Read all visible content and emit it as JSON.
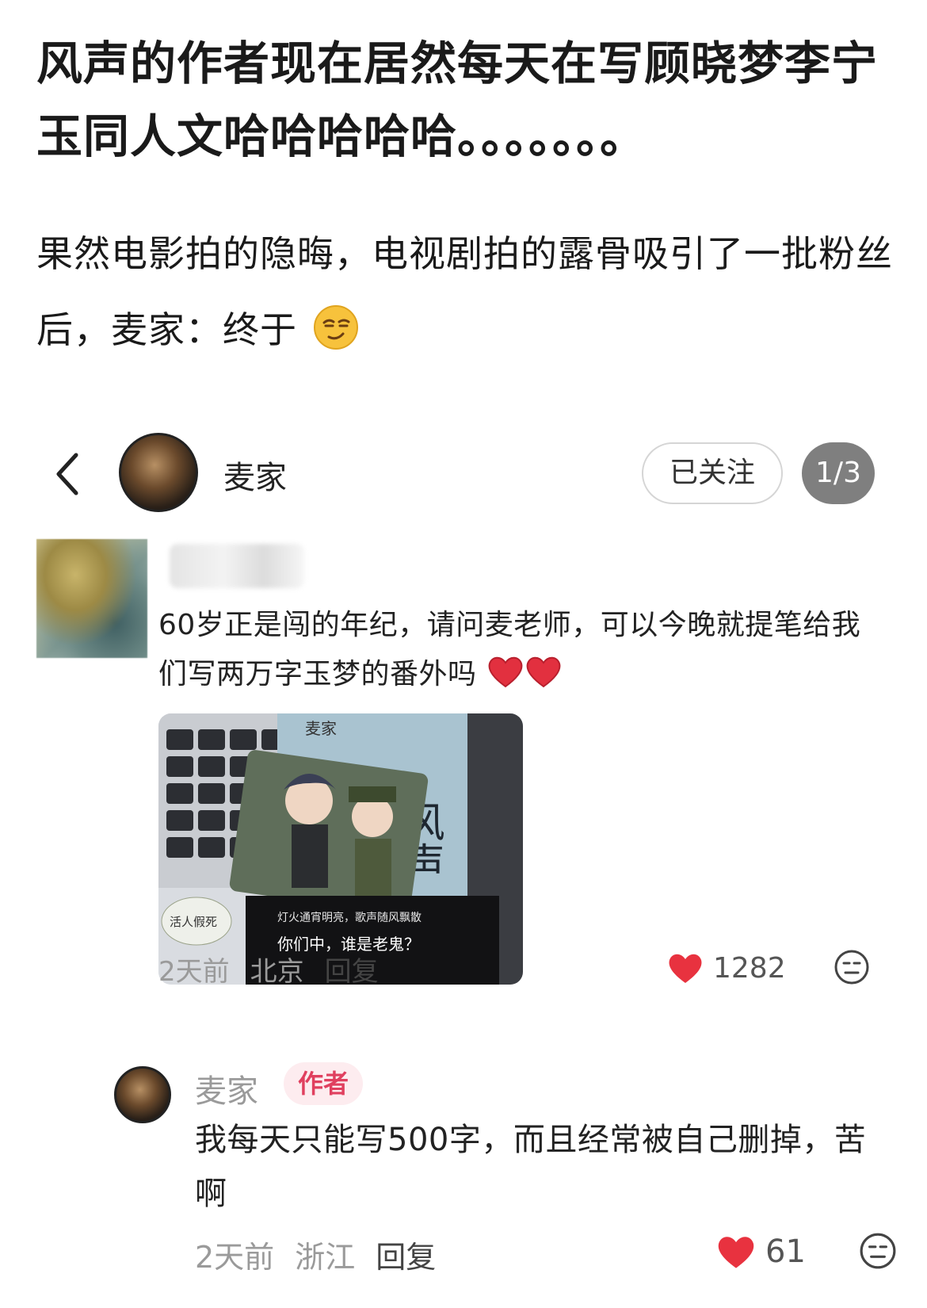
{
  "post": {
    "title": "风声的作者现在居然每天在写顾晓梦李宁玉同人文哈哈哈哈哈。。。。。。。",
    "body": "果然电影拍的隐晦，电视剧拍的露骨吸引了一批粉丝后，麦家：终于"
  },
  "screenshot": {
    "header": {
      "author_name": "麦家",
      "follow_label": "已关注",
      "page_indicator": "1/3"
    },
    "comment": {
      "text": "60岁正是闯的年纪，请问麦老师，可以今晚就提笔给我们写两万字玉梦的番外吗",
      "photo": {
        "book_title": "风声",
        "book_author": "麦家",
        "sticker_text": "活人假死",
        "cover_line1": "灯火通宵明亮，歌声随风飘散",
        "cover_line2": "你们中，谁是老鬼？"
      },
      "time": "2天前",
      "location": "北京",
      "reply_label": "回复",
      "likes": "1282"
    },
    "reply": {
      "author_name": "麦家",
      "badge": "作者",
      "text": "我每天只能写500字，而且经常被自己删掉，苦啊",
      "time": "2天前",
      "location": "浙江",
      "reply_label": "回复",
      "likes": "61"
    }
  },
  "colors": {
    "like_heart": "#e8323f",
    "badge_text": "#e0405f",
    "badge_bg": "#fdecef",
    "page_indicator_bg": "#7f7f7f"
  },
  "icons": [
    "back-arrow-icon",
    "share-arrow-icon",
    "heart-icon",
    "neutral-face-icon",
    "smirk-emoji-icon",
    "red-heart-emoji-icon"
  ]
}
